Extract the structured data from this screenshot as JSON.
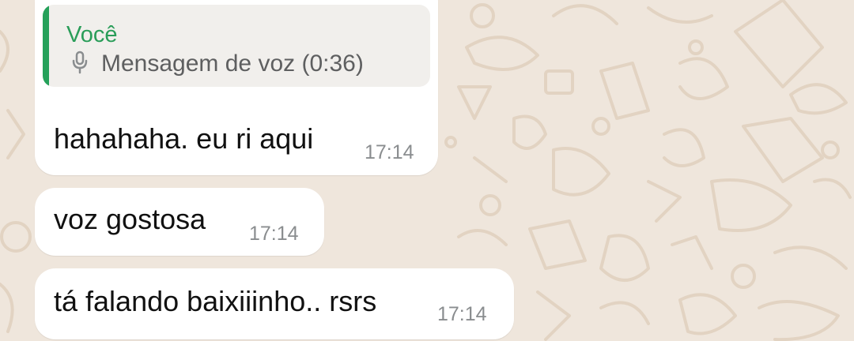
{
  "colors": {
    "background": "#efe6dc",
    "bubble": "#ffffff",
    "quote_accent": "#25a15a",
    "quote_author": "#2a9d59",
    "timestamp": "#8a8d8f"
  },
  "messages": [
    {
      "quote": {
        "author": "Você",
        "icon": "microphone-icon",
        "text": "Mensagem de voz (0:36)"
      },
      "text": "hahahaha. eu ri aqui",
      "time": "17:14"
    },
    {
      "text": "voz gostosa",
      "time": "17:14"
    },
    {
      "text": "tá falando baixiiinho.. rsrs",
      "time": "17:14"
    }
  ]
}
